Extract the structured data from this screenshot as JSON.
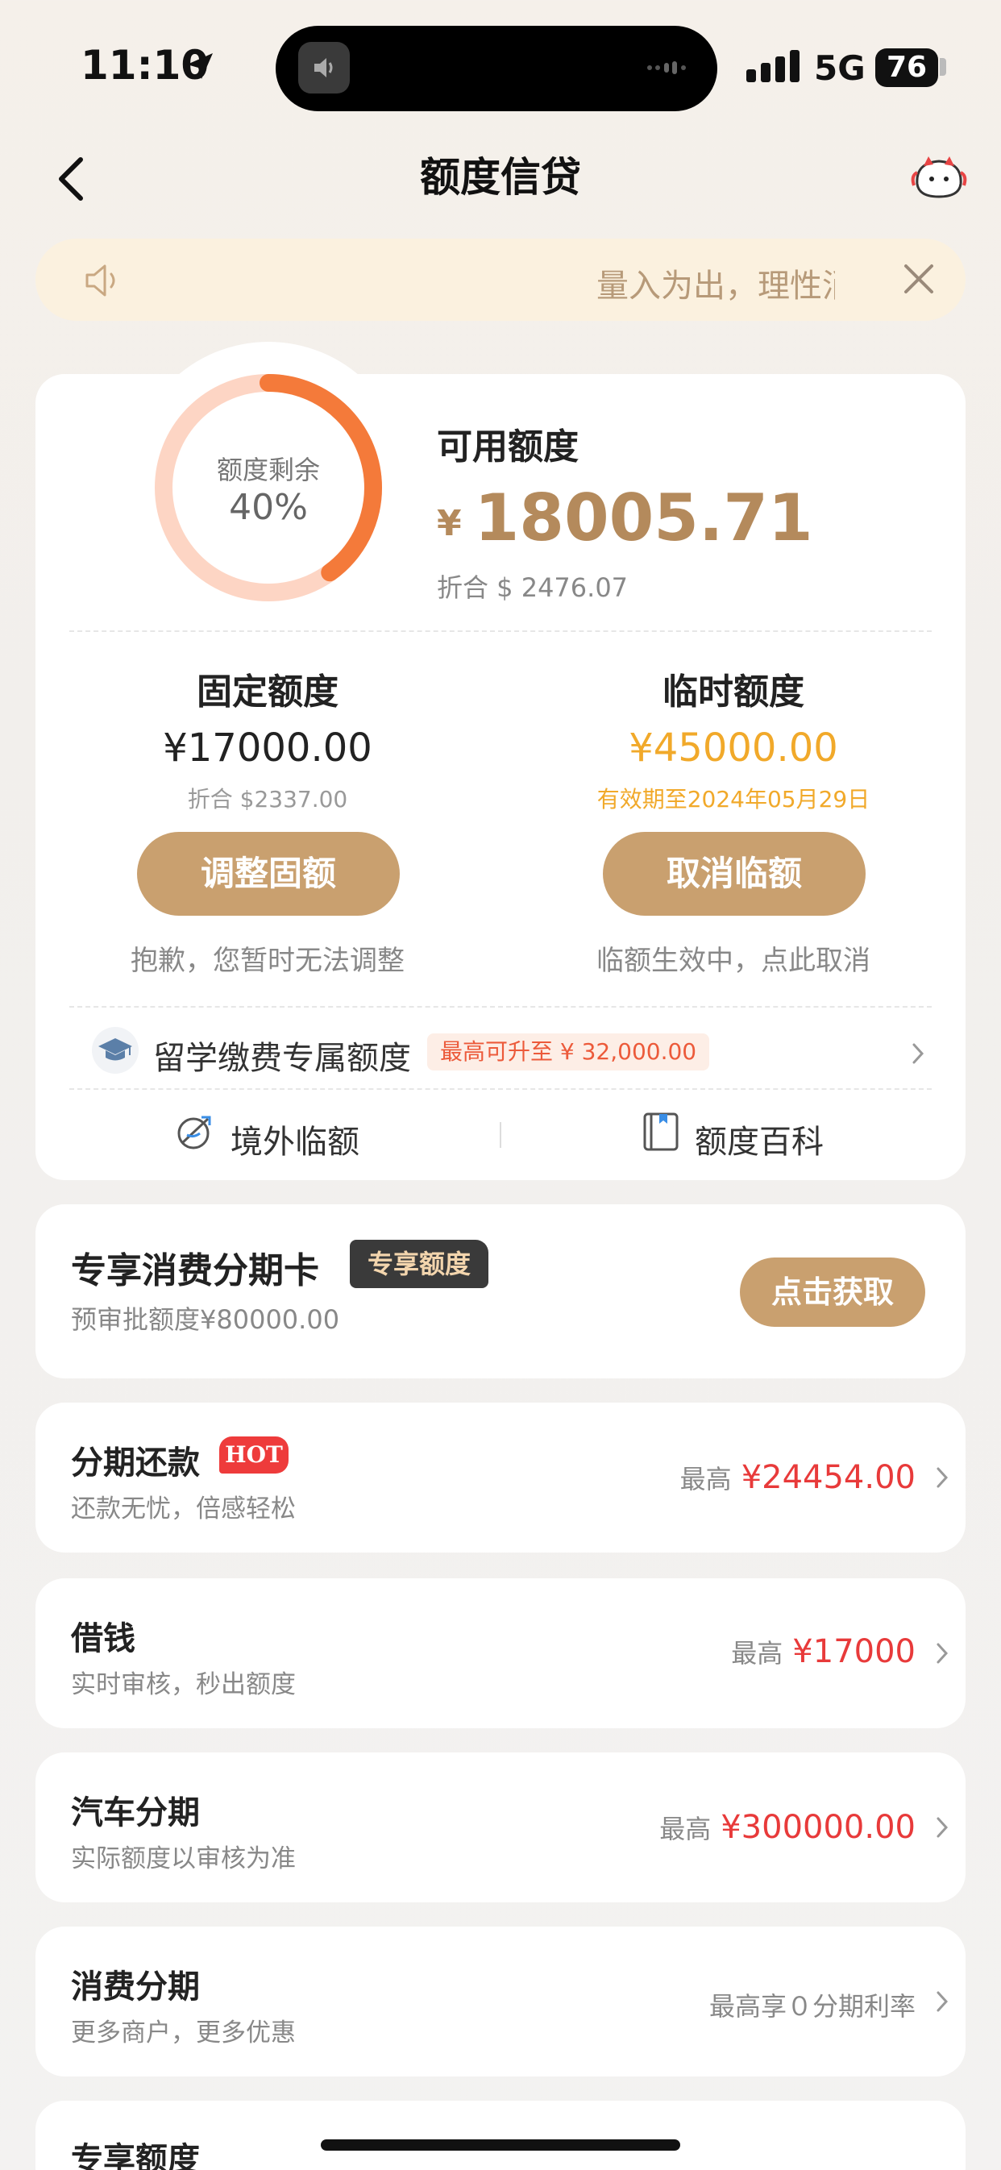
{
  "status": {
    "time": "11:10",
    "network": "5G",
    "battery": "76"
  },
  "header": {
    "title": "额度信贷"
  },
  "notice": {
    "text": "量入为出，理性消费"
  },
  "quota": {
    "ring_label": "额度剩余",
    "ring_percent": "40%",
    "remaining_fraction": 0.4,
    "available_label": "可用额度",
    "currency": "¥",
    "available_amount": "18005.71",
    "available_usd": "折合 $ 2476.07"
  },
  "fixed": {
    "title": "固定额度",
    "amount": "¥17000.00",
    "sub": "折合 $2337.00",
    "button": "调整固额",
    "note": "抱歉，您暂时无法调整"
  },
  "temp": {
    "title": "临时额度",
    "amount": "¥45000.00",
    "sub": "有效期至2024年05月29日",
    "button": "取消临额",
    "note": "临额生效中，点此取消"
  },
  "study": {
    "label": "留学缴费专属额度",
    "badge": "最高可升至 ¥ 32,000.00"
  },
  "links": {
    "overseas": "境外临额",
    "wiki": "额度百科"
  },
  "card": {
    "title": "专享消费分期卡",
    "badge": "专享额度",
    "sub": "预审批额度¥80000.00",
    "button": "点击获取"
  },
  "rows": [
    {
      "title": "分期还款",
      "badge": "HOT",
      "sub": "还款无忧，倍感轻松",
      "max_label": "最高",
      "max_value": "¥24454.00"
    },
    {
      "title": "借钱",
      "sub": "实时审核，秒出额度",
      "max_label": "最高",
      "max_value": "¥17000"
    },
    {
      "title": "汽车分期",
      "sub": "实际额度以审核为准",
      "max_label": "最高",
      "max_value": "¥300000.00"
    },
    {
      "title": "消费分期",
      "sub": "更多商户，更多优惠",
      "right_text": "最高享０分期利率"
    },
    {
      "title": "专享额度"
    }
  ],
  "colors": {
    "accent": "#c9a06f",
    "amount_brown": "#b48a5c",
    "ring_orange": "#f47a3a",
    "ring_light": "#fdd5c4",
    "red": "#e83a3a",
    "temp_yellow": "#f1a92a"
  }
}
